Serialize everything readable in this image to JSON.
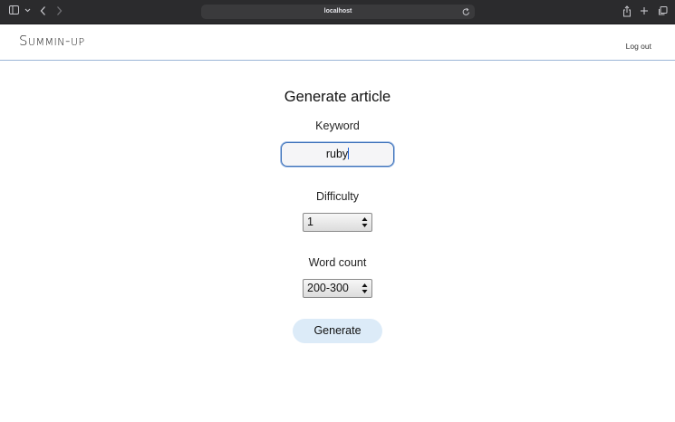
{
  "browser": {
    "url": "localhost",
    "icons": {
      "sidebar": "sidebar-icon",
      "back": "chevron-left-icon",
      "forward": "chevron-right-icon",
      "reload": "reload-icon",
      "share": "share-icon",
      "new_tab": "plus-icon",
      "tabs": "tabs-overview-icon"
    }
  },
  "header": {
    "logo": "Summin-up",
    "logout_label": "Log out",
    "border_color": "#9bb5d6"
  },
  "form": {
    "title": "Generate article",
    "keyword_label": "Keyword",
    "keyword_value": "ruby",
    "difficulty_label": "Difficulty",
    "difficulty_value": "1",
    "word_count_label": "Word count",
    "word_count_value": "200-300",
    "submit_label": "Generate",
    "submit_color": "#dcebf8",
    "focus_color": "#3a6fb8"
  }
}
